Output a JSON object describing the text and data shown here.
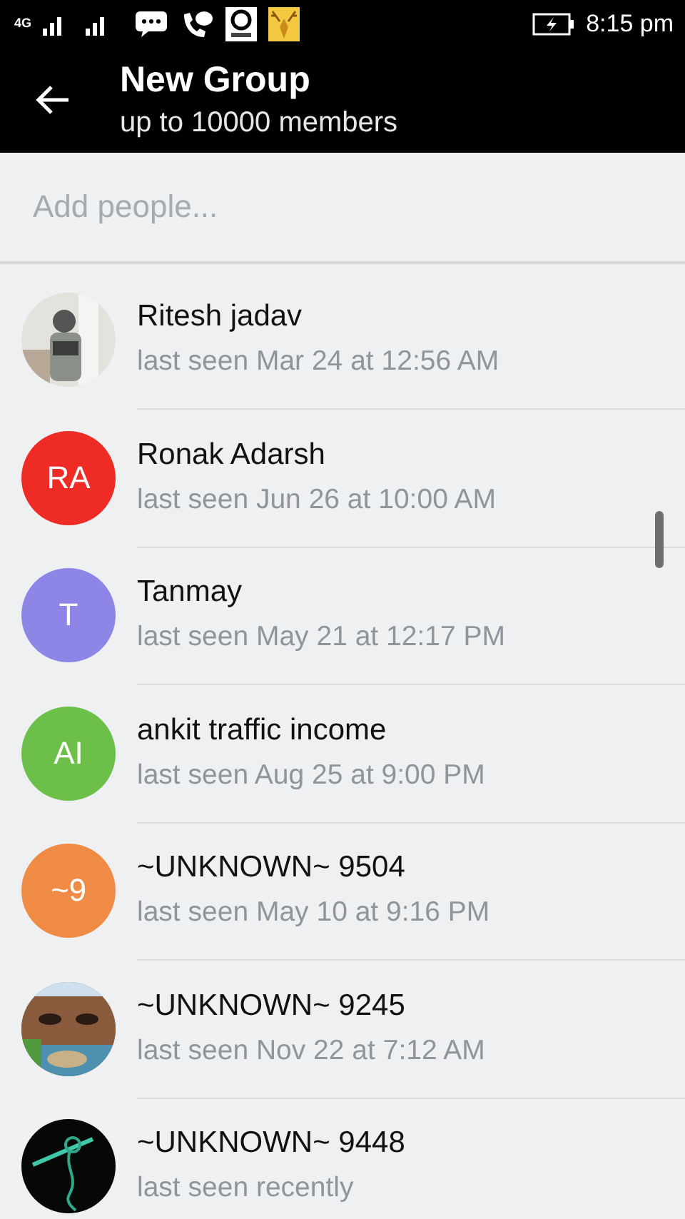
{
  "status_bar": {
    "network": "4G",
    "time": "8:15 pm"
  },
  "header": {
    "title": "New Group",
    "subtitle": "up to 10000 members"
  },
  "search": {
    "placeholder": "Add people..."
  },
  "contacts": [
    {
      "name": "Ritesh jadav",
      "status": "last seen Mar 24 at 12:56 AM"
    },
    {
      "name": "Ronak Adarsh",
      "status": "last seen Jun 26 at 10:00 AM",
      "avatar": {
        "kind": "initials",
        "initials": "RA",
        "color": "#ee2b24"
      }
    },
    {
      "name": "Tanmay",
      "status": "last seen May 21 at 12:17 PM",
      "avatar": {
        "kind": "initials",
        "initials": "T",
        "color": "#8e86e6"
      }
    },
    {
      "name": "ankit traffic income",
      "status": "last seen Aug 25 at 9:00 PM",
      "avatar": {
        "kind": "initials",
        "initials": "AI",
        "color": "#6cc04a"
      }
    },
    {
      "name": "~UNKNOWN~ 9504",
      "status": "last seen May 10 at 9:16 PM",
      "avatar": {
        "kind": "initials",
        "initials": "~9",
        "color": "#f08b45"
      }
    },
    {
      "name": "~UNKNOWN~ 9245",
      "status": "last seen Nov 22 at 7:12 AM"
    },
    {
      "name": "~UNKNOWN~ 9448",
      "status": "last seen recently"
    }
  ]
}
